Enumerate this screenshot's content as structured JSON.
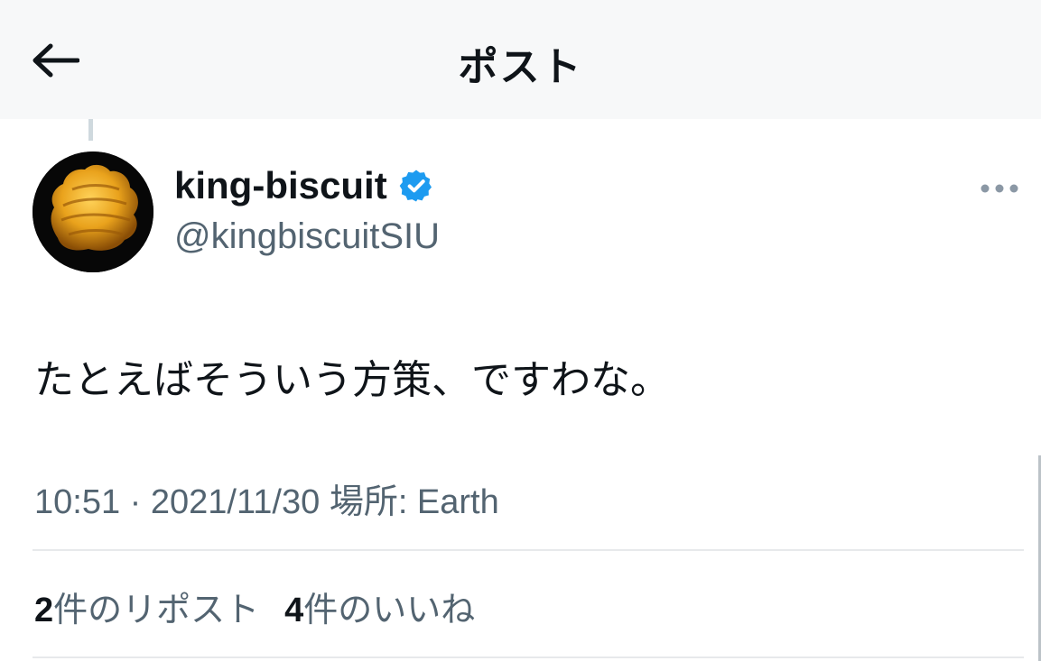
{
  "header": {
    "title": "ポスト",
    "back_icon": "arrow-left-icon"
  },
  "post": {
    "author": {
      "name": "king-biscuit",
      "handle": "@kingbiscuitSIU",
      "verified": true,
      "verified_color": "#1d9bf0"
    },
    "text": "たとえばそういう方策、ですわな。",
    "time": "10:51",
    "separator": "·",
    "date": "2021/11/30",
    "location": "場所: Earth"
  },
  "stats": {
    "reposts_count": "2",
    "reposts_label": "件のリポスト",
    "likes_count": "4",
    "likes_label": "件のいいね"
  },
  "colors": {
    "text": "#0f1419",
    "secondary": "#536471",
    "divider": "#e7e9eb"
  }
}
